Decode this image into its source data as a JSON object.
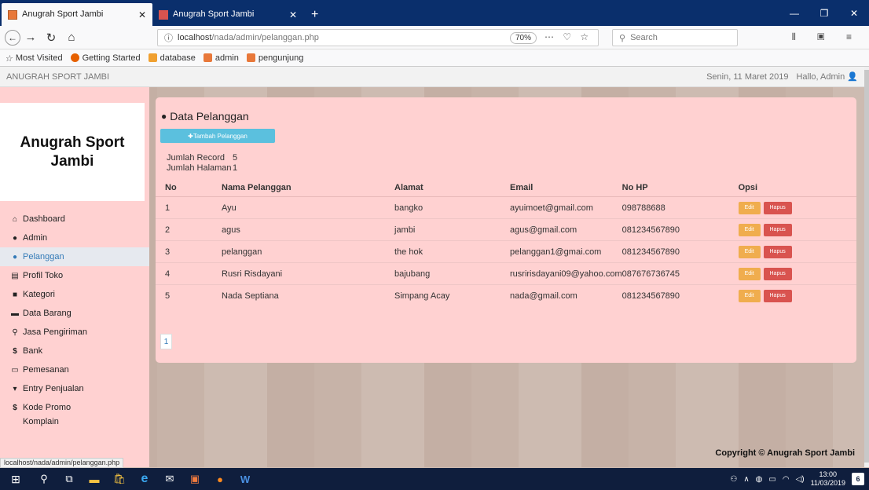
{
  "browser": {
    "tabs": [
      {
        "title": "Anugrah Sport Jambi",
        "active": true
      },
      {
        "title": "Anugrah Sport Jambi",
        "active": false
      }
    ],
    "url_host": "localhost",
    "url_path": "/nada/admin/pelanggan.php",
    "zoom": "70%",
    "search_placeholder": "Search",
    "bookmarks": [
      "Most Visited",
      "Getting Started",
      "database",
      "admin",
      "pengunjung"
    ],
    "status_url": "localhost/nada/admin/pelanggan.php"
  },
  "site": {
    "header_title": "ANUGRAH SPORT JAMBI",
    "date": "Senin, 11 Maret 2019",
    "greeting": "Hallo, Admin",
    "brand_line1": "Anugrah Sport",
    "brand_line2": "Jambi",
    "copyright": "Copyright © Anugrah Sport Jambi"
  },
  "menu": [
    {
      "label": "Dashboard",
      "icon": "home-icon"
    },
    {
      "label": "Admin",
      "icon": "user-icon"
    },
    {
      "label": "Pelanggan",
      "icon": "user-icon",
      "active": true
    },
    {
      "label": "Profil Toko",
      "icon": "list-icon"
    },
    {
      "label": "Kategori",
      "icon": "book-icon"
    },
    {
      "label": "Data Barang",
      "icon": "folder-icon"
    },
    {
      "label": "Jasa Pengiriman",
      "icon": "map-marker-icon"
    },
    {
      "label": "Bank",
      "icon": "dollar-icon"
    },
    {
      "label": "Pemesanan",
      "icon": "comment-icon"
    },
    {
      "label": "Entry Penjualan",
      "icon": "cart-icon"
    },
    {
      "label": "Kode Promo",
      "icon": "dollar-icon"
    },
    {
      "label": "Komplain",
      "icon": "comment-icon"
    }
  ],
  "main": {
    "title": "Data Pelanggan",
    "add_button": "Tambah Pelanggan",
    "jumlah_record_label": "Jumlah Record",
    "jumlah_record_value": "5",
    "jumlah_halaman_label": "Jumlah Halaman",
    "jumlah_halaman_value": "1",
    "columns": [
      "No",
      "Nama Pelanggan",
      "Alamat",
      "Email",
      "No HP",
      "Opsi"
    ],
    "rows": [
      [
        "1",
        "Ayu",
        "bangko",
        "ayuimoet@gmail.com",
        "098788688"
      ],
      [
        "2",
        "agus",
        "jambi",
        "agus@gmail.com",
        "081234567890"
      ],
      [
        "3",
        "pelanggan",
        "the hok",
        "pelanggan1@gmai.com",
        "081234567890"
      ],
      [
        "4",
        "Rusri Risdayani",
        "bajubang",
        "rusririsdayani09@yahoo.com",
        "087676736745"
      ],
      [
        "5",
        "Nada Septiana",
        "Simpang Acay",
        "nada@gmail.com",
        "081234567890"
      ]
    ],
    "edit_label": "Edit",
    "delete_label": "Hapus",
    "page_number": "1"
  },
  "taskbar": {
    "time": "13:00",
    "date": "11/03/2019",
    "notification_count": "6"
  }
}
